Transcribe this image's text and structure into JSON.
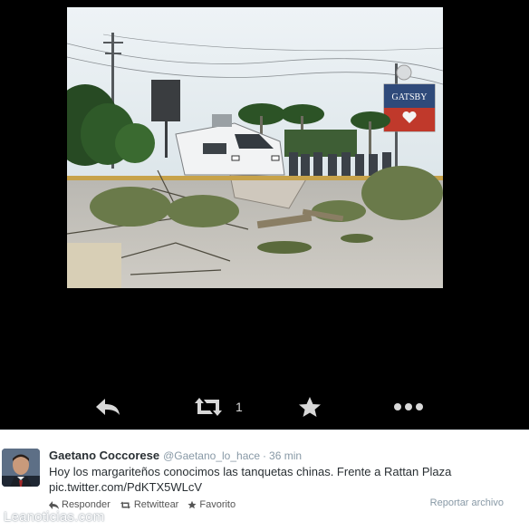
{
  "media": {
    "photo": {
      "billboard_text": "GATSBY"
    },
    "actions": {
      "reply_icon": "reply-icon",
      "retweet_icon": "retweet-icon",
      "retweet_count": "1",
      "favorite_icon": "star-icon",
      "more_icon": "ellipsis-icon"
    }
  },
  "tweet": {
    "author_name": "Gaetano Coccorese",
    "screen_name": "@Gaetano_lo_hace",
    "separator": "·",
    "time": "36 min",
    "text": "Hoy los margariteños conocimos las tanquetas chinas. Frente a Rattan Plaza",
    "link": "pic.twitter.com/PdKTX5WLcV",
    "actions": {
      "reply": "Responder",
      "retweet": "Retwittear",
      "favorite": "Favorito"
    },
    "report": "Reportar archivo"
  },
  "watermark": "Leanoticias.com",
  "colors": {
    "media_background": "#000000",
    "action_icon": "#d8d8d8",
    "text": "#292f33",
    "muted": "#8899a6"
  }
}
